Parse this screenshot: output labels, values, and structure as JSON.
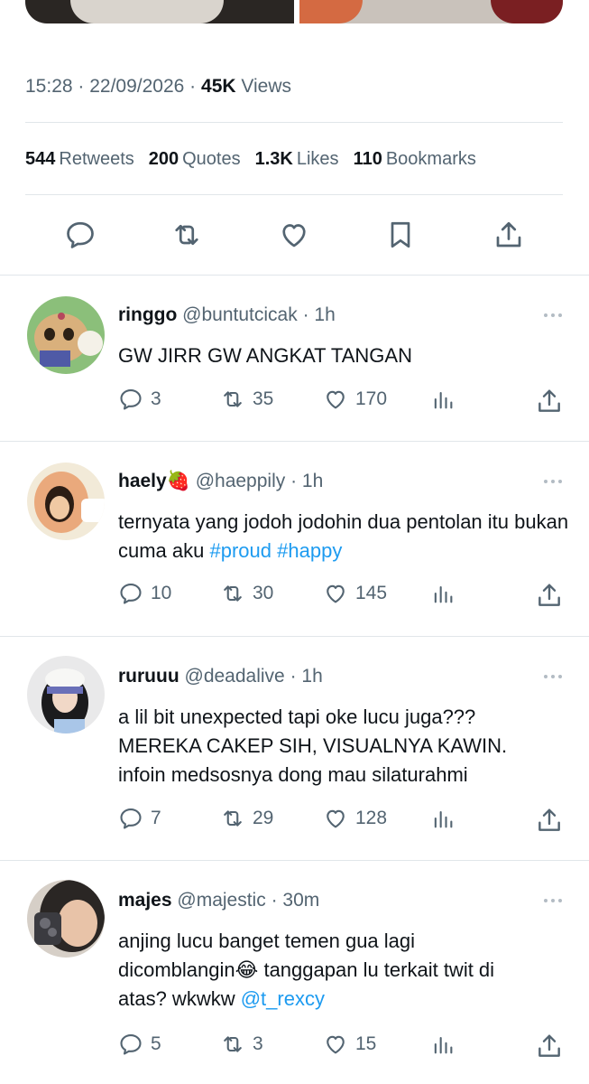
{
  "tweet": {
    "time": "15:28",
    "date": "22/09/2026",
    "views_count": "45K",
    "views_label": "Views",
    "stats": [
      {
        "count": "544",
        "label": "Retweets"
      },
      {
        "count": "200",
        "label": "Quotes"
      },
      {
        "count": "1.3K",
        "label": "Likes"
      },
      {
        "count": "110",
        "label": "Bookmarks"
      }
    ],
    "actions": [
      "reply-icon",
      "retweet-icon",
      "like-icon",
      "bookmark-icon",
      "share-icon"
    ]
  },
  "replies": [
    {
      "name": "ringgo",
      "handle": "@buntutcicak",
      "time": "1h",
      "text": "GW JIRR GW ANGKAT TANGAN",
      "replies": "3",
      "retweets": "35",
      "likes": "170"
    },
    {
      "name": "haely🍓",
      "handle": "@haeppily",
      "time": "1h",
      "text_before": "ternyata yang jodoh jodohin dua pentolan itu bukan cuma aku ",
      "tags": [
        "#proud",
        "#happy"
      ],
      "replies": "10",
      "retweets": "30",
      "likes": "145"
    },
    {
      "name": "ruruuu",
      "handle": "@deadalive",
      "time": "1h",
      "lines": [
        "a lil bit unexpected tapi oke lucu juga???",
        "MEREKA CAKEP SIH, VISUALNYA KAWIN.",
        "infoin medsosnya dong mau silaturahmi"
      ],
      "replies": "7",
      "retweets": "29",
      "likes": "128"
    },
    {
      "name": "majes",
      "handle": "@majestic",
      "time": "30m",
      "lines": [
        "anjing lucu banget temen gua lagi",
        "dicomblangin😂 tanggapan lu terkait twit di",
        "atas? wkwkw "
      ],
      "mention": "@t_rexcy",
      "replies": "5",
      "retweets": "3",
      "likes": "15"
    }
  ],
  "colors": {
    "text": "#0f1419",
    "secondary": "#536471",
    "link": "#1d9bf0",
    "divider": "#e1e6ea"
  }
}
